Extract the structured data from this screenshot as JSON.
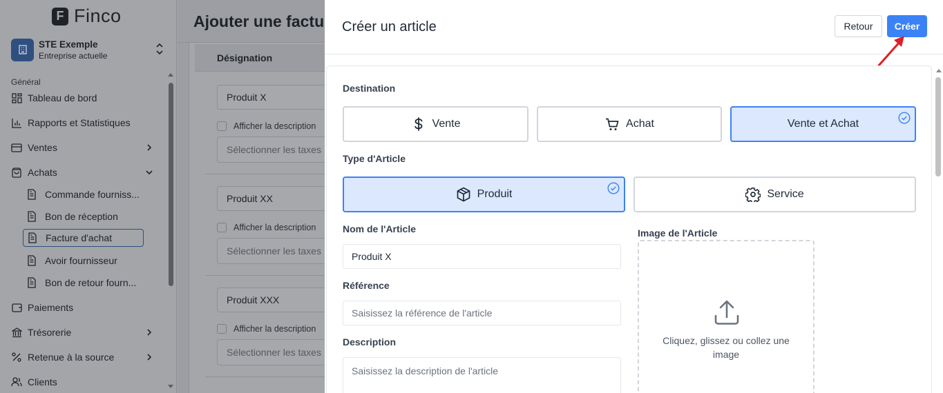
{
  "sidebar": {
    "brand": "Finco",
    "company": {
      "name": "STE Exemple",
      "subtitle": "Entreprise actuelle"
    },
    "section": "Général",
    "items": [
      {
        "label": "Tableau de bord"
      },
      {
        "label": "Rapports et Statistiques"
      },
      {
        "label": "Ventes"
      },
      {
        "label": "Achats"
      },
      {
        "label": "Paiements"
      },
      {
        "label": "Trésorerie"
      },
      {
        "label": "Retenue à la source"
      },
      {
        "label": "Clients"
      }
    ],
    "achats_sub": [
      {
        "label": "Commande fourniss..."
      },
      {
        "label": "Bon de réception"
      },
      {
        "label": "Facture d'achat"
      },
      {
        "label": "Avoir fournisseur"
      },
      {
        "label": "Bon de retour fourn..."
      }
    ]
  },
  "main": {
    "title": "Ajouter une factu",
    "column_header": "Désignation",
    "rows": [
      {
        "product": "Produit X",
        "show_desc": "Afficher la description",
        "taxes_placeholder": "Sélectionner les taxes"
      },
      {
        "product": "Produit XX",
        "show_desc": "Afficher la description",
        "taxes_placeholder": "Sélectionner les taxes"
      },
      {
        "product": "Produit XXX",
        "show_desc": "Afficher la description",
        "taxes_placeholder": "Sélectionner les taxes"
      }
    ]
  },
  "drawer": {
    "title": "Créer un article",
    "back_label": "Retour",
    "create_label": "Créer",
    "destination": {
      "label": "Destination",
      "options": [
        {
          "label": "Vente",
          "icon": "dollar-icon",
          "selected": false
        },
        {
          "label": "Achat",
          "icon": "cart-icon",
          "selected": false
        },
        {
          "label": "Vente et Achat",
          "icon": "",
          "selected": true
        }
      ]
    },
    "type": {
      "label": "Type d'Article",
      "options": [
        {
          "label": "Produit",
          "icon": "box-icon",
          "selected": true
        },
        {
          "label": "Service",
          "icon": "gear-icon",
          "selected": false
        }
      ]
    },
    "name": {
      "label": "Nom de l'Article",
      "value": "Produit X"
    },
    "reference": {
      "label": "Référence",
      "placeholder": "Saisissez la référence de l'article"
    },
    "description": {
      "label": "Description",
      "placeholder": "Saisissez la description de l'article"
    },
    "image": {
      "label": "Image de l'Article",
      "hint": "Cliquez, glissez ou collez une image"
    }
  },
  "colors": {
    "accent": "#3b82f6",
    "selected_bg": "#dbe8fe",
    "annotation_arrow": "#e11d26"
  }
}
